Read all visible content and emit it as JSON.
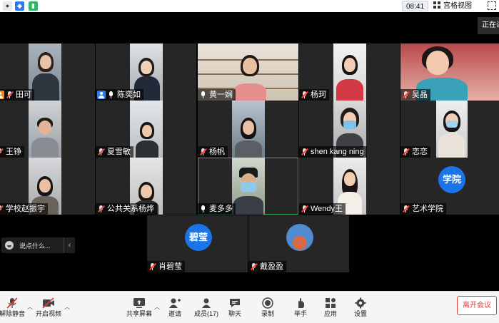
{
  "status_bar": {
    "time": "08:41",
    "view_mode": "宫格视图"
  },
  "talking_label": "正在讲",
  "participants": [
    {
      "name": "田可",
      "muted": true
    },
    {
      "name": "陈奕如",
      "muted": false
    },
    {
      "name": "黄一娴",
      "muted": false
    },
    {
      "name": "杨珂",
      "muted": true
    },
    {
      "name": "吴晶",
      "muted": true
    },
    {
      "name": "王铮",
      "muted": true
    },
    {
      "name": "夏雪敏",
      "muted": true
    },
    {
      "name": "杨帆",
      "muted": true
    },
    {
      "name": "shen kang ning",
      "muted": true
    },
    {
      "name": "恋恋",
      "muted": true
    },
    {
      "name": "学校赵振宇",
      "muted": true
    },
    {
      "name": "公共关系杨烨",
      "muted": true
    },
    {
      "name": "麦多多",
      "muted": false
    },
    {
      "name": "Wendy王",
      "muted": true
    },
    {
      "name": "艺术学院",
      "muted": true,
      "avatar_text": "学院"
    },
    {
      "name": "肖碧莹",
      "muted": true,
      "avatar_text": "碧莹"
    },
    {
      "name": "戴盈盈",
      "muted": true
    }
  ],
  "chat": {
    "placeholder": "说点什么..."
  },
  "toolbar": {
    "unmute": "解除静音",
    "start_video": "开启视频",
    "share_screen": "共享屏幕",
    "invite": "邀请",
    "members": "成员(17)",
    "chat": "聊天",
    "record": "录制",
    "raise_hand": "举手",
    "apps": "应用",
    "settings": "设置",
    "leave": "离开会议"
  },
  "colors": {
    "accent": "#1c74e9",
    "leave": "#e03c3c",
    "active_speaker": "#2fb36d"
  }
}
